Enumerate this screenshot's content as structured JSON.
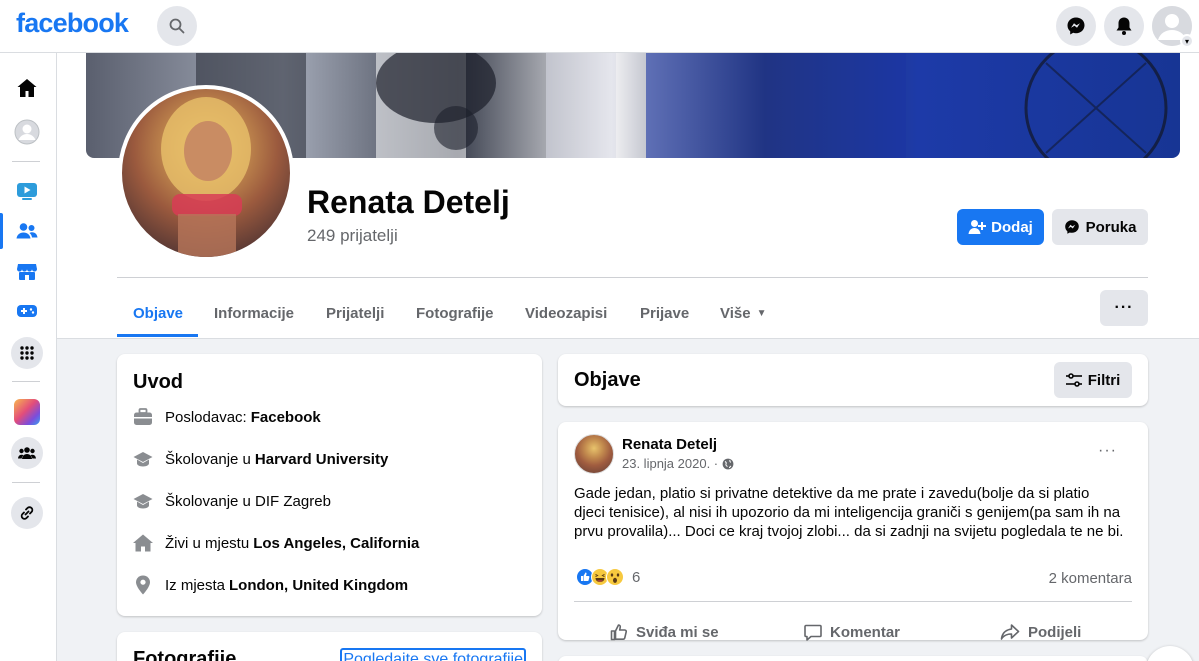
{
  "topbar": {
    "logo": "facebook"
  },
  "profile": {
    "name": "Renata Detelj",
    "friends_count": "249 prijatelji",
    "add_button": "Dodaj",
    "message_button": "Poruka"
  },
  "tabs": [
    "Objave",
    "Informacije",
    "Prijatelji",
    "Fotografije",
    "Videozapisi",
    "Prijave",
    "Više"
  ],
  "more_menu": "···",
  "intro": {
    "title": "Uvod",
    "rows": [
      {
        "icon": "briefcase-icon",
        "prefix": "Poslodavac:",
        "bold": "Facebook"
      },
      {
        "icon": "graduation-cap-icon",
        "prefix": "Školovanje u",
        "bold": "Harvard University"
      },
      {
        "icon": "graduation-cap-icon",
        "prefix": "Školovanje u DIF Zagreb",
        "bold": ""
      },
      {
        "icon": "house-icon",
        "prefix": "Živi u mjestu",
        "bold": "Los Angeles, California"
      },
      {
        "icon": "location-pin-icon",
        "prefix": "Iz mjesta",
        "bold": "London, United Kingdom"
      }
    ]
  },
  "photos_card": {
    "title": "Fotografije",
    "link": "Pogledajte sve fotografije"
  },
  "posts_header": {
    "title": "Objave",
    "filter_button": "Filtri"
  },
  "post": {
    "author": "Renata Detelj",
    "date": "23. lipnja 2020. ·",
    "text": "Gade jedan, platio si privatne detektive da me prate i zavedu(bolje da si platio djeci tenisice), al nisi ih upozorio da mi inteligencija graniči s genijem(pa sam ih na prvu provalila)... Doci ce kraj tvojoj zlobi... da si zadnji na svijetu pogledala te ne bi.",
    "reactions_count": "6",
    "comments": "2 komentara",
    "like": "Sviđa mi se",
    "comment": "Komentar",
    "share": "Podijeli"
  },
  "colors": {
    "brand": "#1877f2",
    "background": "#f0f2f5",
    "secondary_text": "#65676b"
  }
}
